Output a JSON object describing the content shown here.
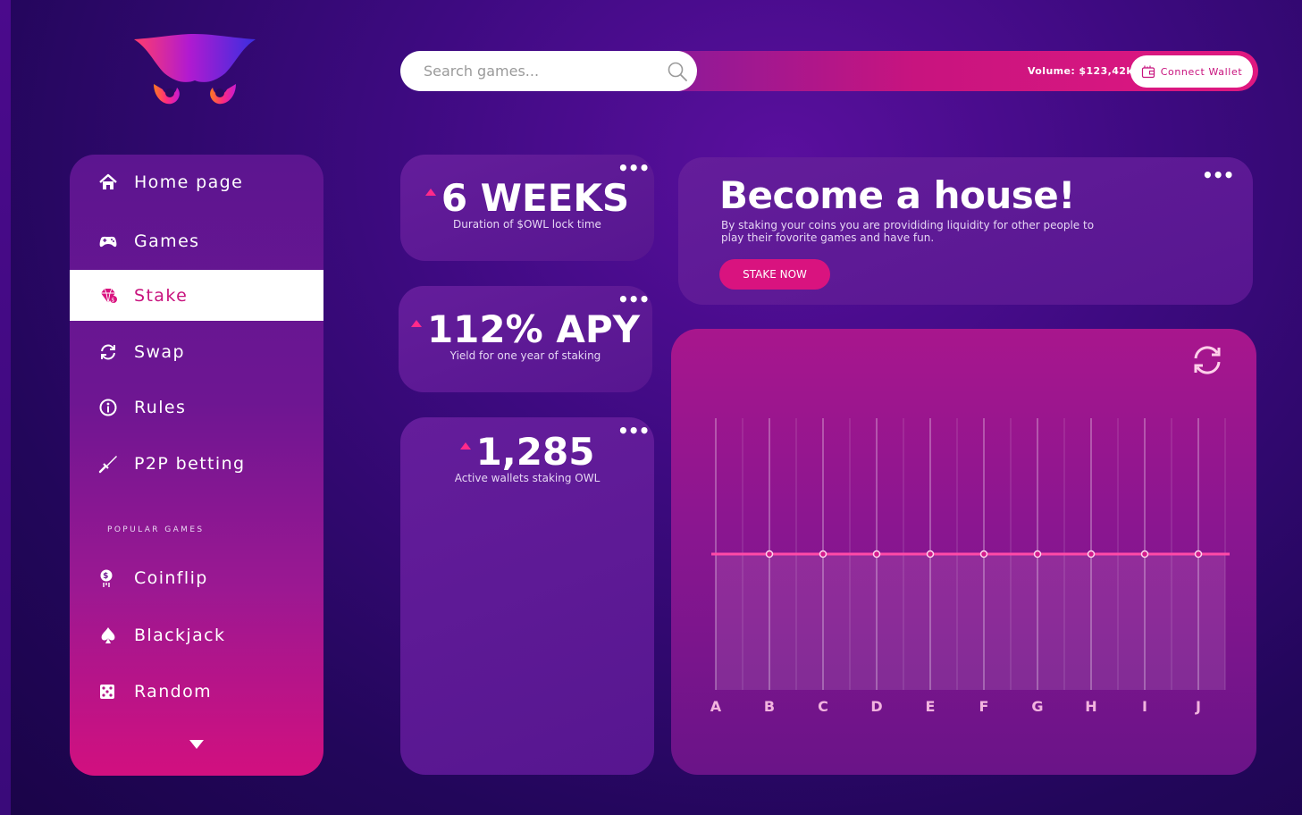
{
  "search": {
    "placeholder": "Search games..."
  },
  "header": {
    "volume": "Volume: $123,42k",
    "connect_wallet": "Connect Wallet"
  },
  "sidebar": {
    "items": [
      {
        "label": "Home page",
        "icon": "home-icon"
      },
      {
        "label": "Games",
        "icon": "gamepad-icon"
      },
      {
        "label": "Stake",
        "icon": "diamond-icon",
        "active": true
      },
      {
        "label": "Swap",
        "icon": "swap-icon"
      },
      {
        "label": "Rules",
        "icon": "info-icon"
      },
      {
        "label": "P2P betting",
        "icon": "dagger-icon"
      }
    ],
    "section_label": "POPULAR GAMES",
    "games": [
      {
        "label": "Coinflip",
        "icon": "coin-icon"
      },
      {
        "label": "Blackjack",
        "icon": "spade-icon"
      },
      {
        "label": "Random",
        "icon": "dice-icon"
      }
    ]
  },
  "stats": [
    {
      "value": "6 WEEKS",
      "label": "Duration of $OWL lock time"
    },
    {
      "value": "112% APY",
      "label": "Yield for one year of staking"
    },
    {
      "value": "1,285",
      "label": "Active wallets staking OWL"
    }
  ],
  "promo": {
    "title": "Become a house!",
    "text": "By staking your coins you are provididing liquidity for other people to play their fovorite games and have fun.",
    "button": "STAKE NOW"
  },
  "colors": {
    "accent": "#d9137f",
    "background": "#3d0a80",
    "line": "#ff4aa8"
  },
  "chart_data": {
    "type": "line",
    "categories": [
      "A",
      "B",
      "C",
      "D",
      "E",
      "F",
      "G",
      "H",
      "I",
      "J"
    ],
    "series": [
      {
        "values": [
          5,
          5,
          5,
          5,
          5,
          5,
          5,
          5,
          5,
          5
        ]
      }
    ],
    "ylim": [
      0,
      10
    ],
    "grid": true
  }
}
